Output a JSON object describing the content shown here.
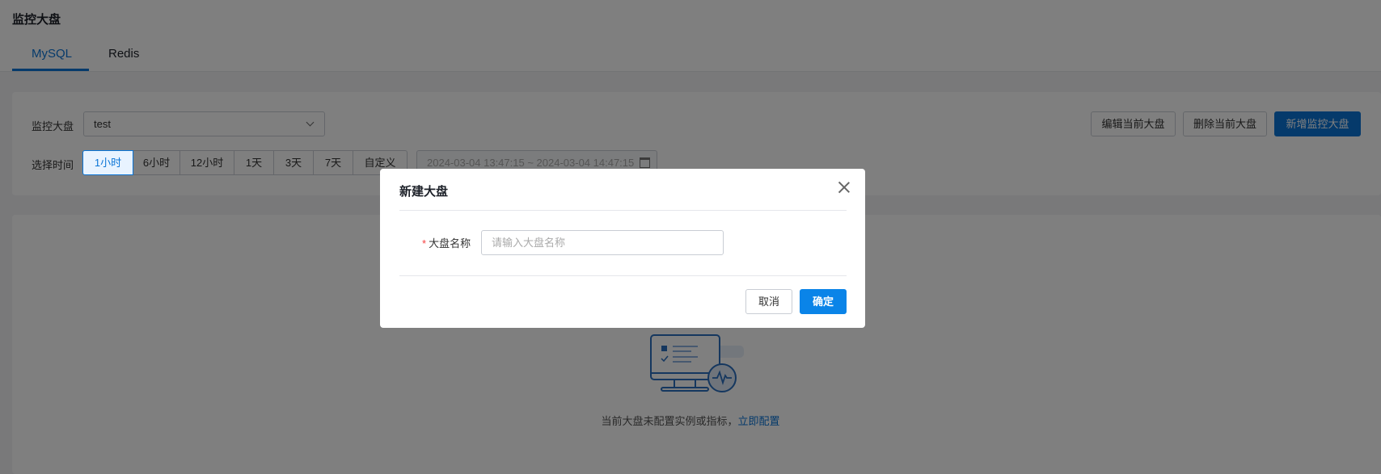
{
  "header": {
    "title": "监控大盘",
    "tabs": [
      {
        "label": "MySQL",
        "active": true
      },
      {
        "label": "Redis",
        "active": false
      }
    ]
  },
  "toolbar": {
    "dashboard_label": "监控大盘",
    "dashboard_value": "test",
    "time_label": "选择时间",
    "time_options": [
      "1小时",
      "6小时",
      "12小时",
      "1天",
      "3天",
      "7天",
      "自定义"
    ],
    "time_selected": "1小时",
    "date_range": "2024-03-04 13:47:15 ~ 2024-03-04 14:47:15",
    "edit_label": "编辑当前大盘",
    "delete_label": "删除当前大盘",
    "add_label": "新增监控大盘"
  },
  "empty": {
    "text": "当前大盘未配置实例或指标，",
    "link": "立即配置"
  },
  "dialog": {
    "title": "新建大盘",
    "field_label": "大盘名称",
    "required_mark": "*",
    "placeholder": "请输入大盘名称",
    "cancel_label": "取消",
    "ok_label": "确定"
  },
  "colors": {
    "accent": "#0a74d6",
    "primary_button": "#0a84e8",
    "required": "#f53f3f"
  }
}
